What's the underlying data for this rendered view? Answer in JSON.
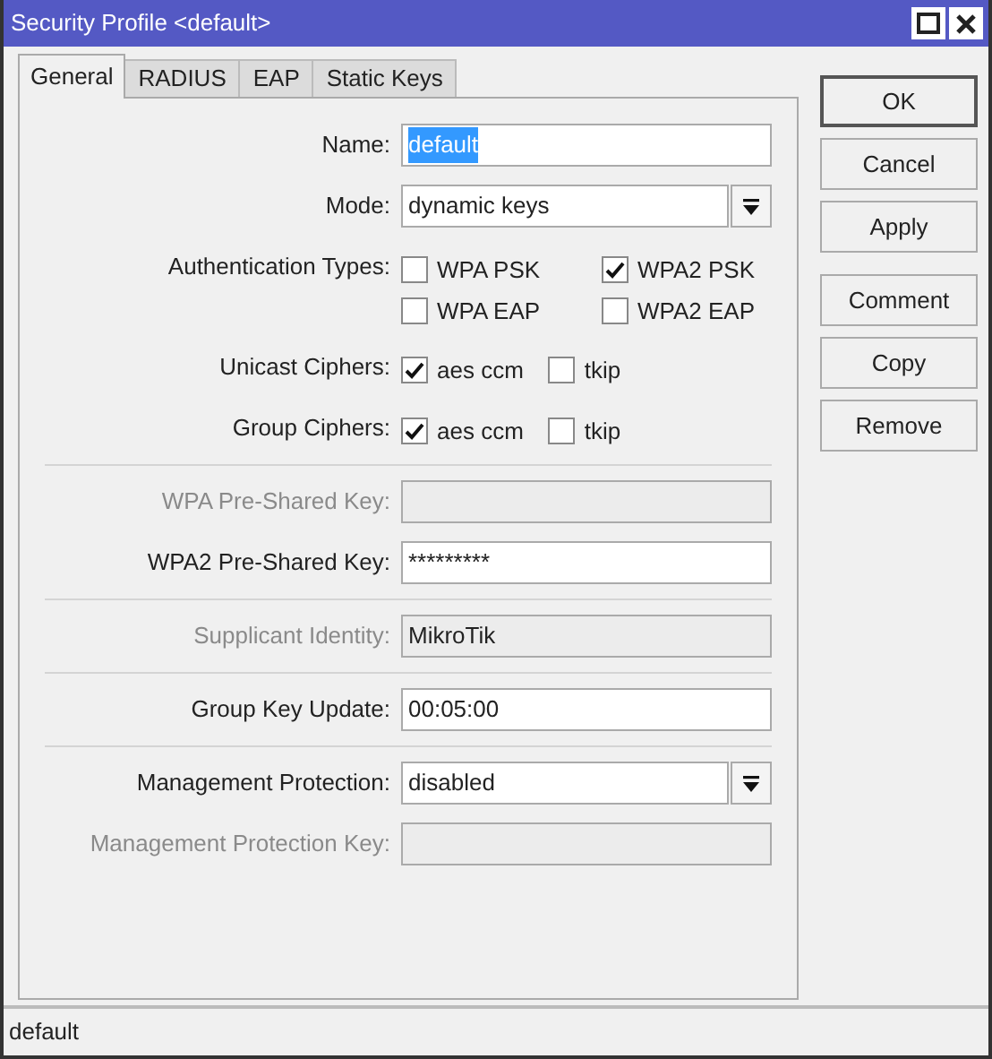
{
  "window": {
    "title": "Security Profile <default>"
  },
  "tabs": [
    {
      "label": "General",
      "selected": true
    },
    {
      "label": "RADIUS",
      "selected": false
    },
    {
      "label": "EAP",
      "selected": false
    },
    {
      "label": "Static Keys",
      "selected": false
    }
  ],
  "sections": [
    [
      {
        "kind": "text",
        "label": "Name:",
        "value": "default",
        "disabled": false,
        "highlighted": true
      },
      {
        "kind": "select",
        "label": "Mode:",
        "value": "dynamic keys",
        "disabled": false
      },
      {
        "kind": "check-grid",
        "label": "Authentication Types:",
        "options": [
          {
            "label": "WPA PSK",
            "checked": false
          },
          {
            "label": "WPA2 PSK",
            "checked": true
          },
          {
            "label": "WPA EAP",
            "checked": false
          },
          {
            "label": "WPA2 EAP",
            "checked": false
          }
        ]
      },
      {
        "kind": "checks",
        "label": "Unicast Ciphers:",
        "options": [
          {
            "label": "aes ccm",
            "checked": true
          },
          {
            "label": "tkip",
            "checked": false
          }
        ]
      },
      {
        "kind": "checks",
        "label": "Group Ciphers:",
        "options": [
          {
            "label": "aes ccm",
            "checked": true
          },
          {
            "label": "tkip",
            "checked": false
          }
        ]
      }
    ],
    [
      {
        "kind": "text",
        "label": "WPA Pre-Shared Key:",
        "disabled": true
      },
      {
        "kind": "text",
        "label": "WPA2 Pre-Shared Key:",
        "value": "*********",
        "disabled": false
      }
    ],
    [
      {
        "kind": "text",
        "label": "Supplicant Identity:",
        "value": "MikroTik",
        "disabled": true
      }
    ],
    [
      {
        "kind": "text",
        "label": "Group Key Update:",
        "value": "00:05:00",
        "disabled": false
      }
    ],
    [
      {
        "kind": "select",
        "label": "Management Protection:",
        "value": "disabled",
        "disabled": false
      },
      {
        "kind": "text",
        "label": "Management Protection Key:",
        "disabled": true
      }
    ]
  ],
  "buttons": [
    "OK",
    "Cancel",
    "Apply",
    "Comment",
    "Copy",
    "Remove"
  ],
  "status_bar": "default"
}
